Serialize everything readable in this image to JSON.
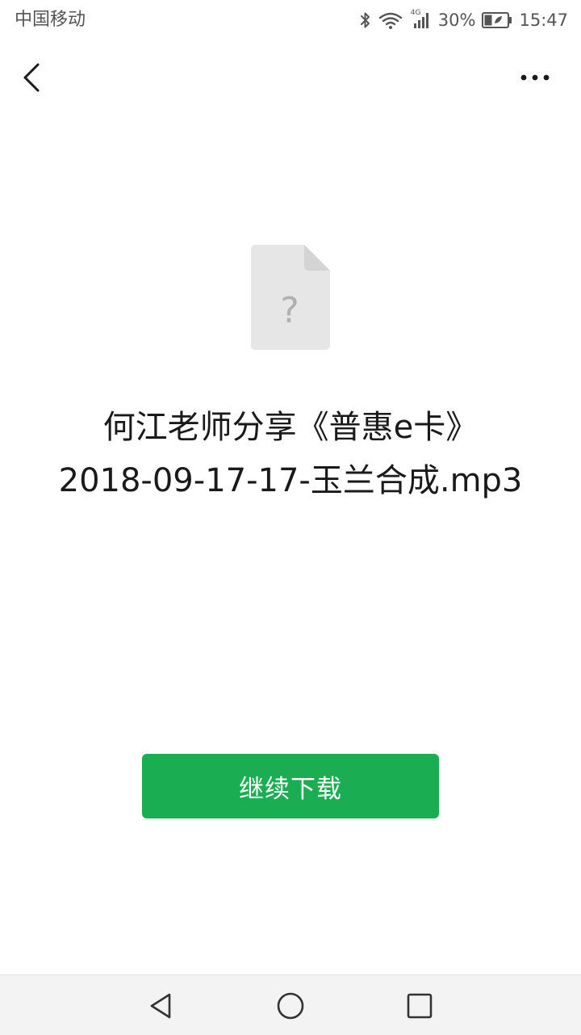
{
  "status_bar": {
    "carrier": "中国移动",
    "network_label": "4G",
    "battery_percent": "30%",
    "time": "15:47",
    "icons": [
      "bluetooth-icon",
      "wifi-icon",
      "cellular-signal-icon",
      "battery-icon"
    ]
  },
  "nav": {
    "back_icon": "chevron-left-icon",
    "more_icon": "more-horizontal-icon"
  },
  "file": {
    "icon": "unknown-file-icon",
    "icon_glyph": "?",
    "name_line1": "何江老师分享《普惠e卡》",
    "name_line2": "2018-09-17-17-玉兰合成.mp3"
  },
  "actions": {
    "continue_download_label": "继续下载"
  },
  "system_nav": {
    "back_icon": "triangle-back-icon",
    "home_icon": "circle-home-icon",
    "recent_icon": "square-recent-icon"
  },
  "colors": {
    "accent": "#1aad52",
    "file_icon_bg": "#e6e6e6",
    "text": "#1a1a1a",
    "status_text": "#555555"
  }
}
